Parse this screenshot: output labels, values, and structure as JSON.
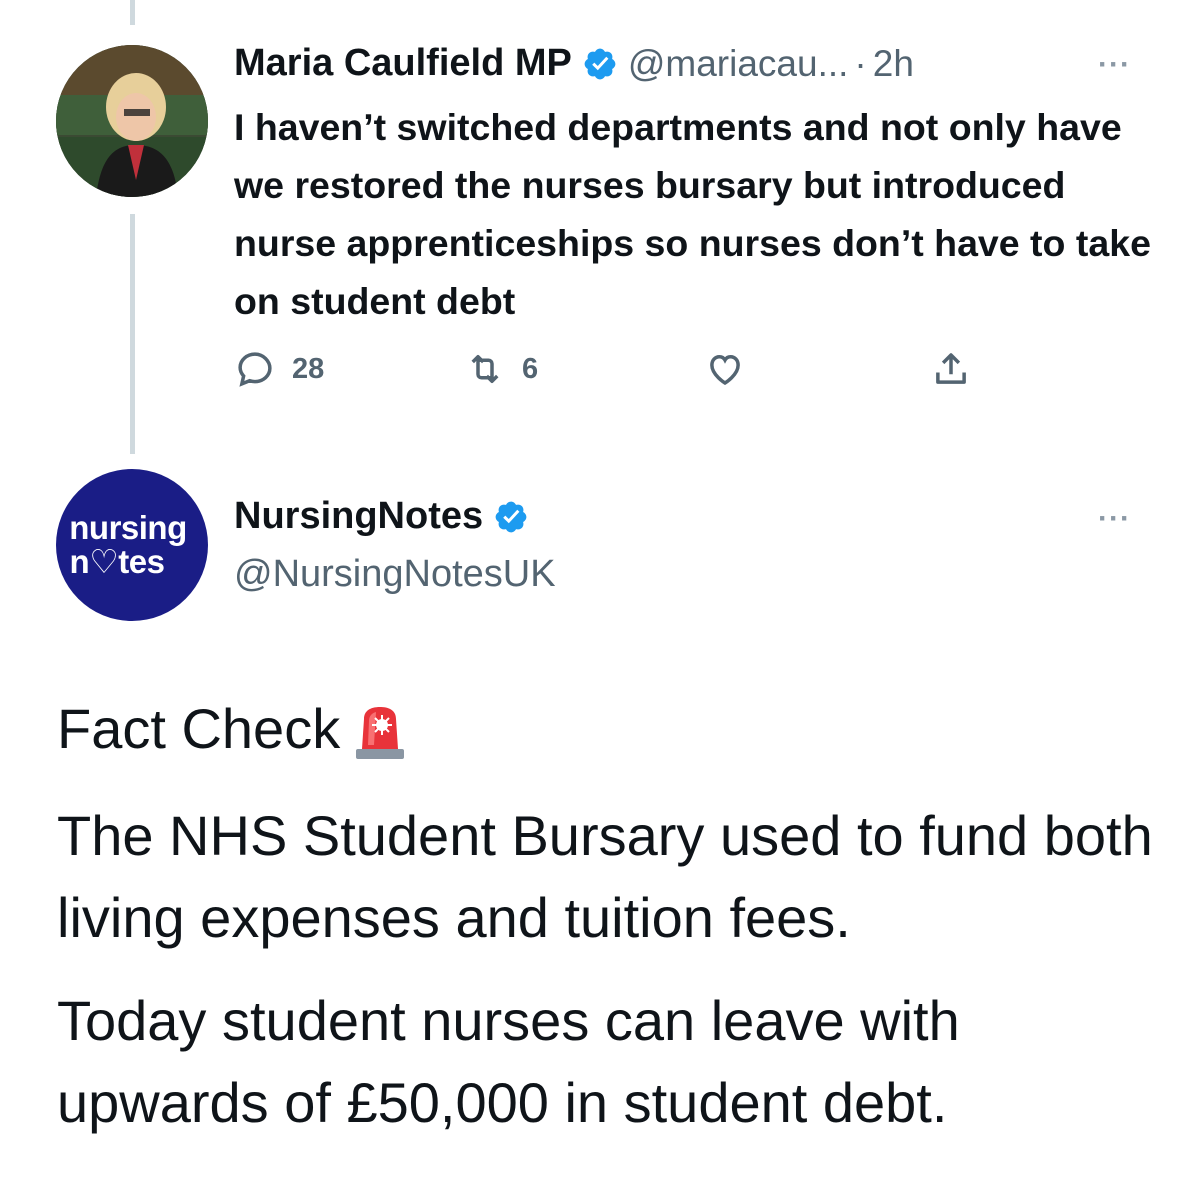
{
  "reply_tweet": {
    "author_name": "Maria Caulfield MP",
    "handle": "@mariacau...",
    "separator": "·",
    "time": "2h",
    "more_label": "···",
    "text": "I haven’t switched departments and not only have we restored the nurses bursary but introduced nurse apprenticeships so nurses don’t have to take on student debt",
    "reply_count": "28",
    "retweet_count": "6",
    "icons": {
      "reply": "reply-icon",
      "retweet": "retweet-icon",
      "like": "heart-icon",
      "share": "share-icon",
      "verified": "verified-badge-icon"
    }
  },
  "main_tweet": {
    "author_name": "NursingNotes",
    "handle": "@NursingNotesUK",
    "more_label": "···",
    "avatar_text_1": "nursing",
    "avatar_text_2": "n♡tes",
    "paragraph_1": "Fact Check",
    "paragraph_2": "The NHS Student Bursary used to fund both living expenses and tuition fees.",
    "paragraph_3": "Today student nurses can leave with upwards of £50,000 in student debt.",
    "icons": {
      "siren": "rotating-light-icon",
      "verified": "verified-badge-icon"
    }
  },
  "colors": {
    "text": "#0f1419",
    "secondary": "#536471",
    "verified_blue": "#1d9bf0",
    "thread_line": "#cfd9de",
    "nursingnotes_navy": "#1a1d86"
  }
}
